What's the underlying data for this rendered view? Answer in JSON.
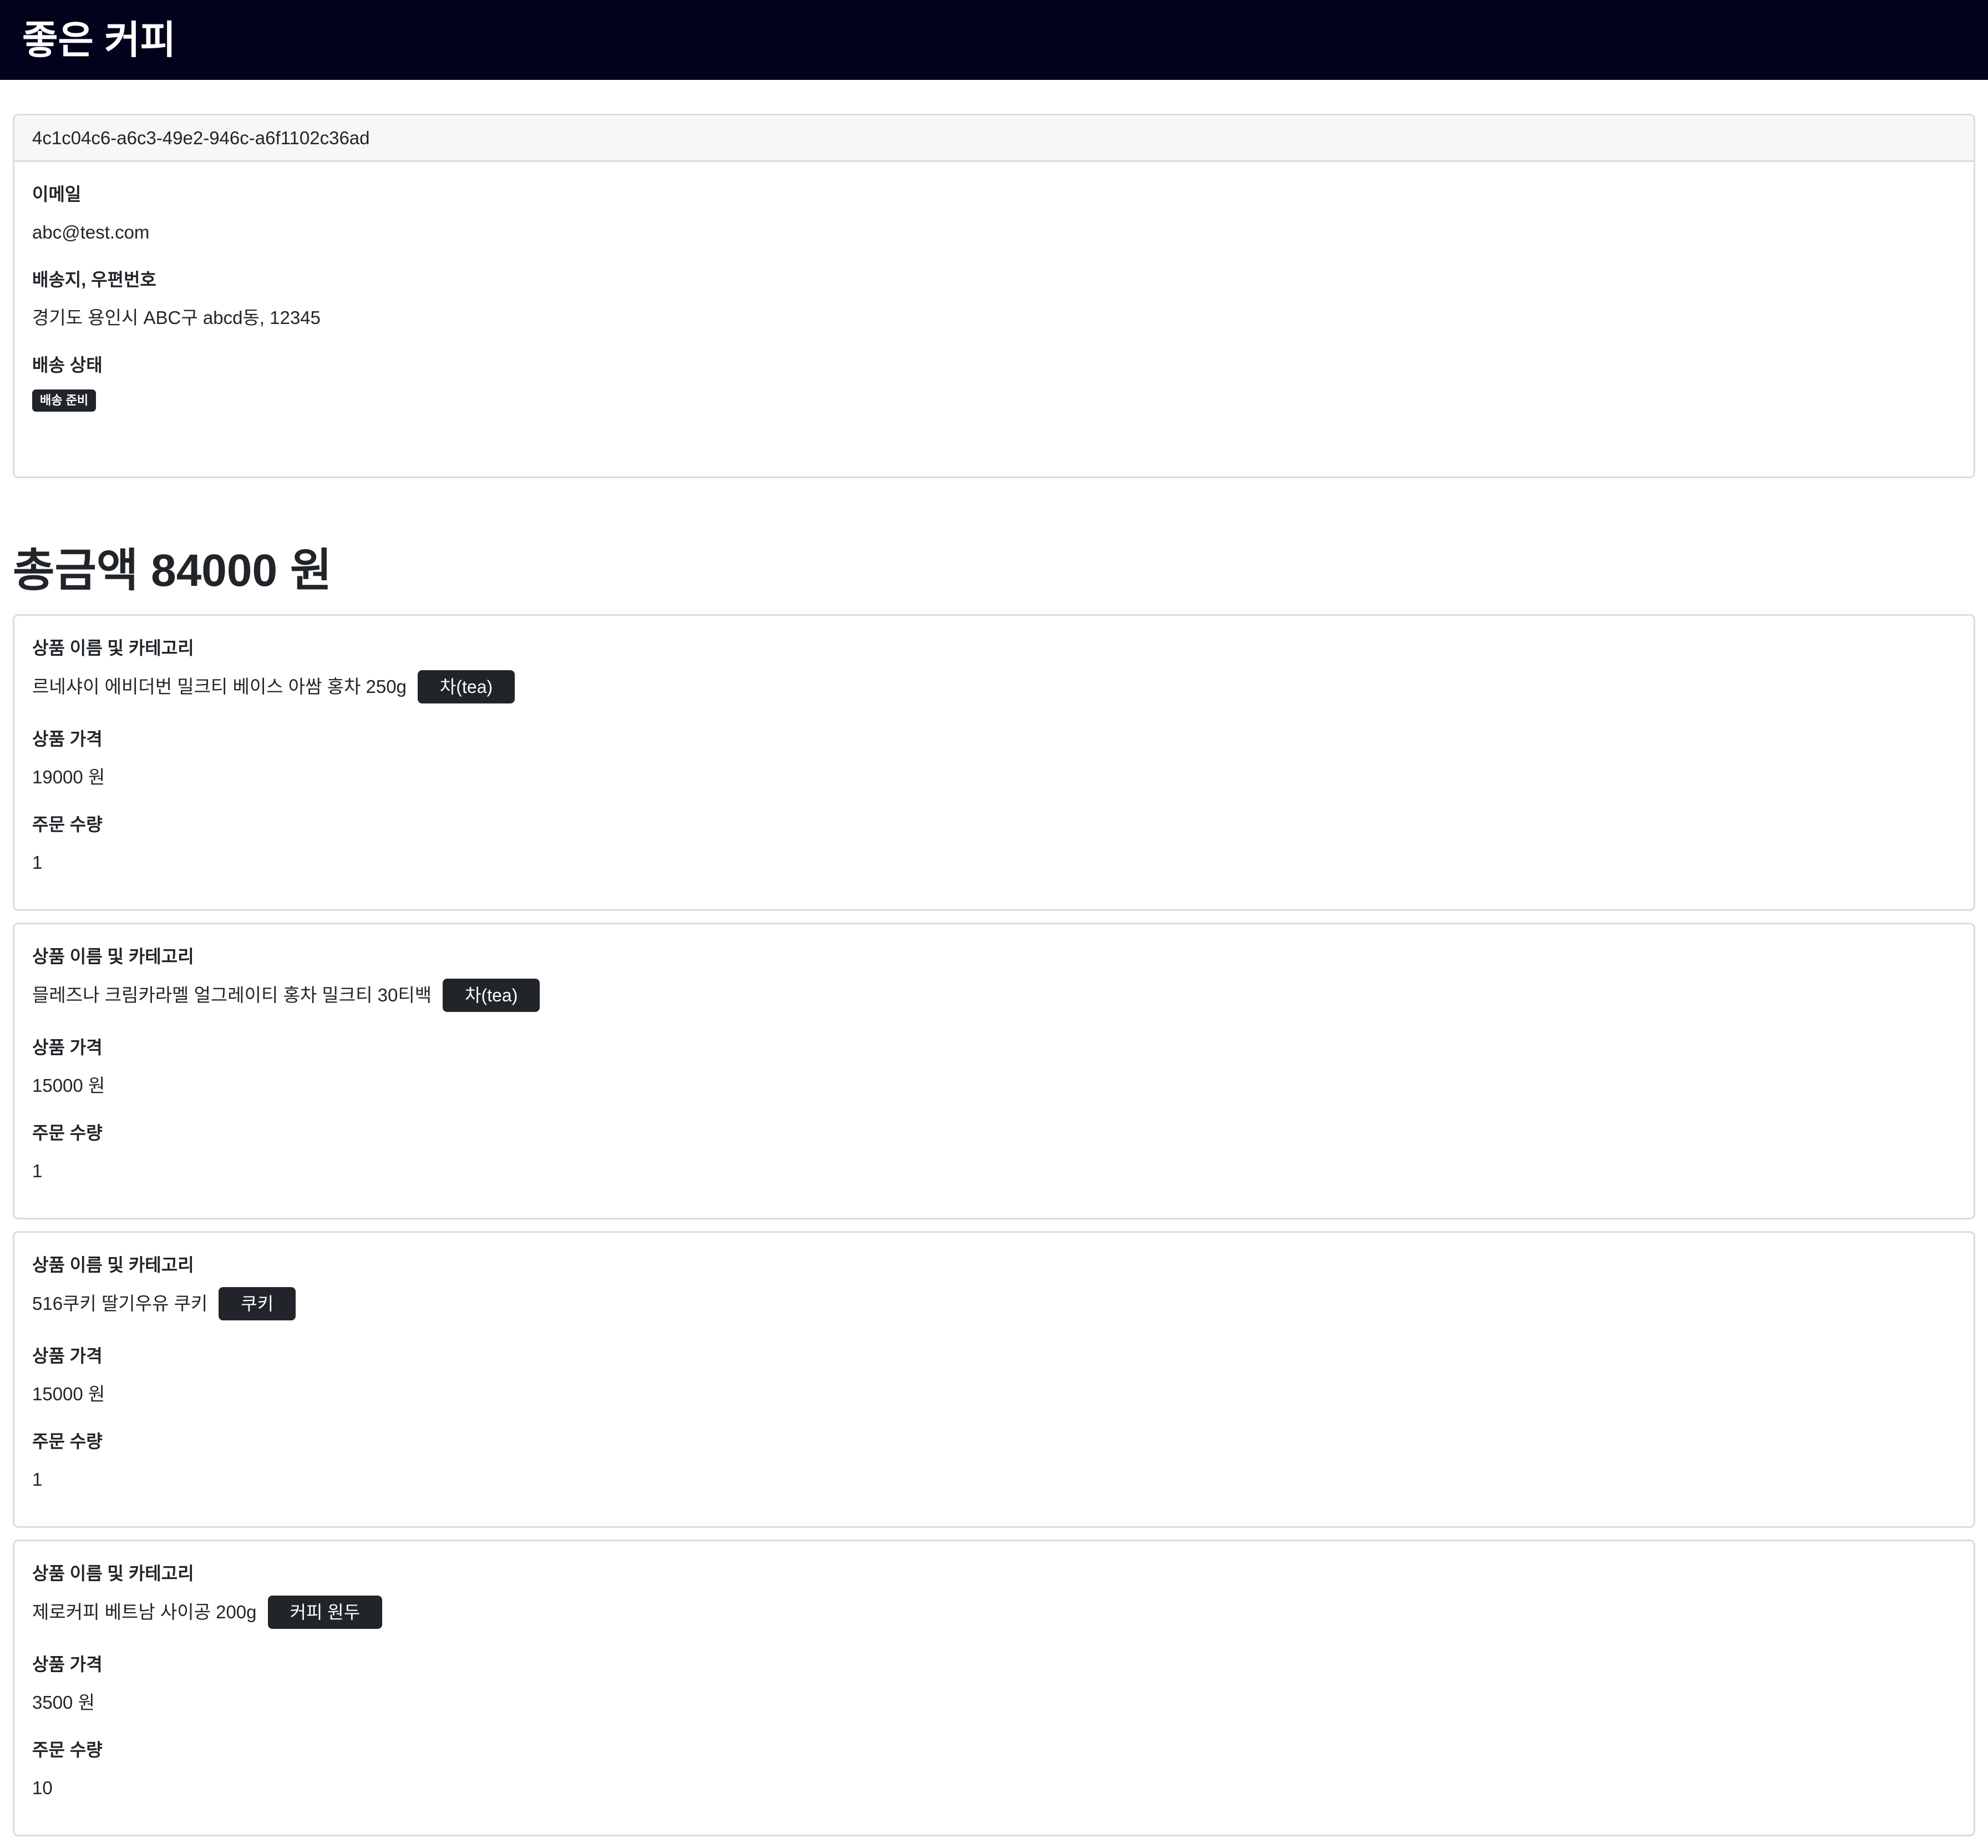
{
  "header": {
    "brand": "좋은 커피"
  },
  "order": {
    "id": "4c1c04c6-a6c3-49e2-946c-a6f1102c36ad",
    "email_label": "이메일",
    "email": "abc@test.com",
    "address_label": "배송지, 우편번호",
    "address": "경기도 용인시 ABC구 abcd동, 12345",
    "status_label": "배송 상태",
    "status": "배송 준비"
  },
  "total": "총금액 84000 원",
  "items": [
    {
      "name_label": "상품 이름 및 카테고리",
      "name": "르네샤이 에비더번 밀크티 베이스 아쌈 홍차 250g",
      "category": "차(tea)",
      "price_label": "상품 가격",
      "price": "19000 원",
      "qty_label": "주문 수량",
      "qty": "1"
    },
    {
      "name_label": "상품 이름 및 카테고리",
      "name": "믈레즈나 크림카라멜 얼그레이티 홍차 밀크티 30티백",
      "category": "차(tea)",
      "price_label": "상품 가격",
      "price": "15000 원",
      "qty_label": "주문 수량",
      "qty": "1"
    },
    {
      "name_label": "상품 이름 및 카테고리",
      "name": "516쿠키 딸기우유 쿠키",
      "category": "쿠키",
      "price_label": "상품 가격",
      "price": "15000 원",
      "qty_label": "주문 수량",
      "qty": "1"
    },
    {
      "name_label": "상품 이름 및 카테고리",
      "name": "제로커피 베트남 사이공 200g",
      "category": "커피 원두",
      "price_label": "상품 가격",
      "price": "3500 원",
      "qty_label": "주문 수량",
      "qty": "10"
    }
  ]
}
